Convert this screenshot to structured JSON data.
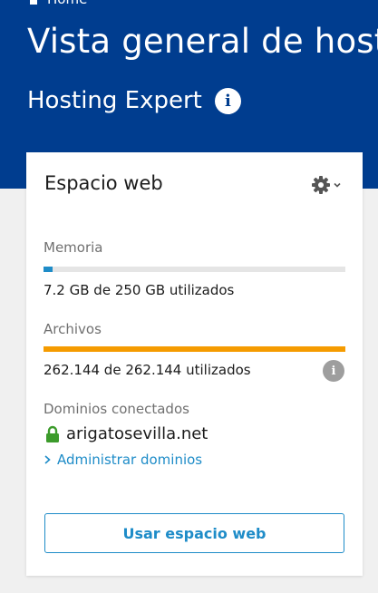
{
  "header": {
    "breadcrumb": "Home",
    "title": "Vista general de hosting",
    "subtitle": "Hosting Expert",
    "info_icon": "info-icon"
  },
  "card": {
    "title": "Espacio web",
    "settings_icon": "gear-icon",
    "memory": {
      "label": "Memoria",
      "usage": "7.2 GB de 250 GB utilizados",
      "fill": 0.029,
      "color": "#1e8cc8"
    },
    "files": {
      "label": "Archivos",
      "usage": "262.144 de 262.144 utilizados",
      "fill": 1.0,
      "color": "#f59b00"
    },
    "domains": {
      "label": "Dominios conectados",
      "domain": "arigatosevilla.net",
      "lock_icon": "lock-icon",
      "manage_link": "Administrar dominios"
    },
    "cta": "Usar espacio web"
  },
  "colors": {
    "header_bg": "#003d8f",
    "accent": "#1e8cc8",
    "warning": "#f59b00",
    "secure": "#3c9b2b"
  }
}
